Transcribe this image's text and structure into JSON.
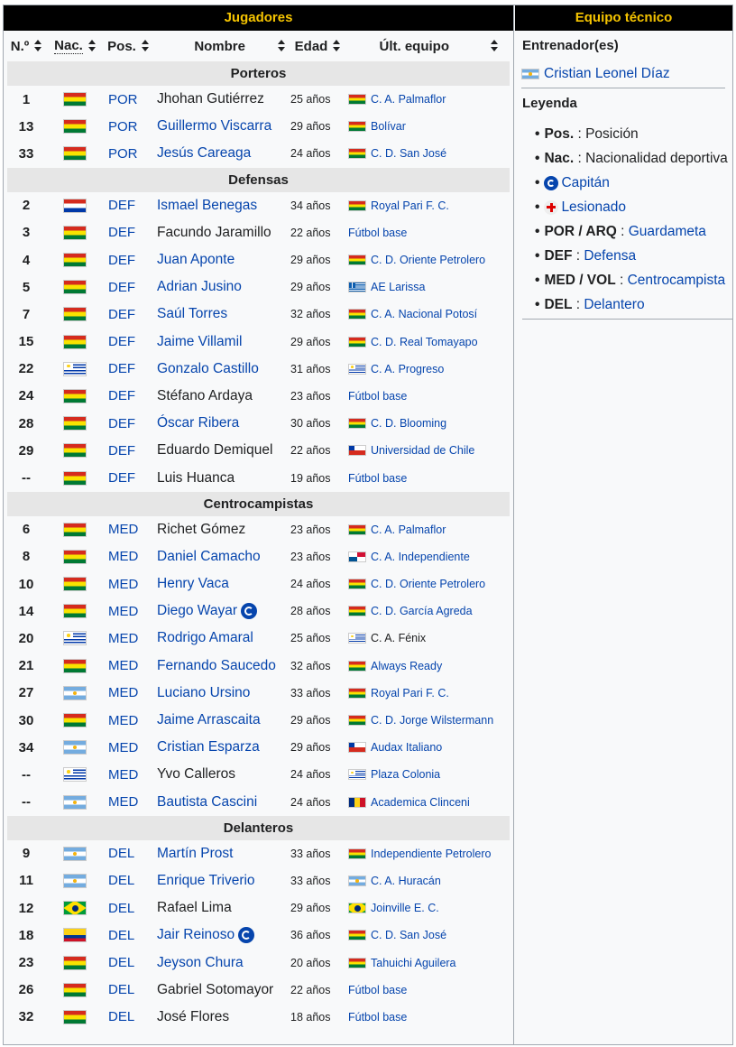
{
  "header": {
    "players_title": "Jugadores",
    "staff_title": "Equipo técnico"
  },
  "columns": {
    "num": "N.º",
    "nac": "Nac.",
    "pos": "Pos.",
    "name": "Nombre",
    "age": "Edad",
    "club": "Últ. equipo"
  },
  "sections": [
    {
      "title": "Porteros",
      "players": [
        {
          "num": "1",
          "nac": "bol",
          "pos": "POR",
          "name": "Jhohan Gutiérrez",
          "linked": false,
          "captain": false,
          "age": "25 años",
          "club_flag": "bol",
          "club": "C. A. Palmaflor",
          "club_linked": true
        },
        {
          "num": "13",
          "nac": "bol",
          "pos": "POR",
          "name": "Guillermo Viscarra",
          "linked": true,
          "captain": false,
          "age": "29 años",
          "club_flag": "bol",
          "club": "Bolívar",
          "club_linked": true
        },
        {
          "num": "33",
          "nac": "bol",
          "pos": "POR",
          "name": "Jesús Careaga",
          "linked": true,
          "captain": false,
          "age": "24 años",
          "club_flag": "bol",
          "club": "C. D. San José",
          "club_linked": true
        }
      ]
    },
    {
      "title": "Defensas",
      "players": [
        {
          "num": "2",
          "nac": "par",
          "pos": "DEF",
          "name": "Ismael Benegas",
          "linked": true,
          "captain": false,
          "age": "34 años",
          "club_flag": "bol",
          "club": "Royal Pari F. C.",
          "club_linked": true
        },
        {
          "num": "3",
          "nac": "bol",
          "pos": "DEF",
          "name": "Facundo Jaramillo",
          "linked": false,
          "captain": false,
          "age": "22 años",
          "club_flag": "",
          "club": "Fútbol base",
          "club_linked": true
        },
        {
          "num": "4",
          "nac": "bol",
          "pos": "DEF",
          "name": "Juan Aponte",
          "linked": true,
          "captain": false,
          "age": "29 años",
          "club_flag": "bol",
          "club": "C. D. Oriente Petrolero",
          "club_linked": true
        },
        {
          "num": "5",
          "nac": "bol",
          "pos": "DEF",
          "name": "Adrian Jusino",
          "linked": true,
          "captain": false,
          "age": "29 años",
          "club_flag": "gre",
          "club": "AE Larissa",
          "club_linked": true
        },
        {
          "num": "7",
          "nac": "bol",
          "pos": "DEF",
          "name": "Saúl Torres",
          "linked": true,
          "captain": false,
          "age": "32 años",
          "club_flag": "bol",
          "club": "C. A. Nacional Potosí",
          "club_linked": true
        },
        {
          "num": "15",
          "nac": "bol",
          "pos": "DEF",
          "name": "Jaime Villamil",
          "linked": true,
          "captain": false,
          "age": "29 años",
          "club_flag": "bol",
          "club": "C. D. Real Tomayapo",
          "club_linked": true
        },
        {
          "num": "22",
          "nac": "uru",
          "pos": "DEF",
          "name": "Gonzalo Castillo",
          "linked": true,
          "captain": false,
          "age": "31 años",
          "club_flag": "uru",
          "club": "C. A. Progreso",
          "club_linked": true
        },
        {
          "num": "24",
          "nac": "bol",
          "pos": "DEF",
          "name": "Stéfano Ardaya",
          "linked": false,
          "captain": false,
          "age": "23 años",
          "club_flag": "",
          "club": "Fútbol base",
          "club_linked": true
        },
        {
          "num": "28",
          "nac": "bol",
          "pos": "DEF",
          "name": "Óscar Ribera",
          "linked": true,
          "captain": false,
          "age": "30 años",
          "club_flag": "bol",
          "club": "C. D. Blooming",
          "club_linked": true
        },
        {
          "num": "29",
          "nac": "bol",
          "pos": "DEF",
          "name": "Eduardo Demiquel",
          "linked": false,
          "captain": false,
          "age": "22 años",
          "club_flag": "chi",
          "club": "Universidad de Chile",
          "club_linked": true
        },
        {
          "num": "--",
          "nac": "bol",
          "pos": "DEF",
          "name": "Luis Huanca",
          "linked": false,
          "captain": false,
          "age": "19 años",
          "club_flag": "",
          "club": "Fútbol base",
          "club_linked": true
        }
      ]
    },
    {
      "title": "Centrocampistas",
      "players": [
        {
          "num": "6",
          "nac": "bol",
          "pos": "MED",
          "name": "Richet Gómez",
          "linked": false,
          "captain": false,
          "age": "23 años",
          "club_flag": "bol",
          "club": "C. A. Palmaflor",
          "club_linked": true
        },
        {
          "num": "8",
          "nac": "bol",
          "pos": "MED",
          "name": "Daniel Camacho",
          "linked": true,
          "captain": false,
          "age": "23 años",
          "club_flag": "pan",
          "club": "C. A. Independiente",
          "club_linked": true
        },
        {
          "num": "10",
          "nac": "bol",
          "pos": "MED",
          "name": "Henry Vaca",
          "linked": true,
          "captain": false,
          "age": "24 años",
          "club_flag": "bol",
          "club": "C. D. Oriente Petrolero",
          "club_linked": true
        },
        {
          "num": "14",
          "nac": "bol",
          "pos": "MED",
          "name": "Diego Wayar",
          "linked": true,
          "captain": true,
          "age": "28 años",
          "club_flag": "bol",
          "club": "C. D. García Agreda",
          "club_linked": true
        },
        {
          "num": "20",
          "nac": "uru",
          "pos": "MED",
          "name": "Rodrigo Amaral",
          "linked": true,
          "captain": false,
          "age": "25 años",
          "club_flag": "uru",
          "club": "C. A. Fénix",
          "club_linked": false
        },
        {
          "num": "21",
          "nac": "bol",
          "pos": "MED",
          "name": "Fernando Saucedo",
          "linked": true,
          "captain": false,
          "age": "32 años",
          "club_flag": "bol",
          "club": "Always Ready",
          "club_linked": true
        },
        {
          "num": "27",
          "nac": "arg",
          "pos": "MED",
          "name": "Luciano Ursino",
          "linked": true,
          "captain": false,
          "age": "33 años",
          "club_flag": "bol",
          "club": "Royal Pari F. C.",
          "club_linked": true
        },
        {
          "num": "30",
          "nac": "bol",
          "pos": "MED",
          "name": "Jaime Arrascaita",
          "linked": true,
          "captain": false,
          "age": "29 años",
          "club_flag": "bol",
          "club": "C. D. Jorge Wilstermann",
          "club_linked": true
        },
        {
          "num": "34",
          "nac": "arg",
          "pos": "MED",
          "name": "Cristian Esparza",
          "linked": true,
          "captain": false,
          "age": "29 años",
          "club_flag": "chi",
          "club": "Audax Italiano",
          "club_linked": true
        },
        {
          "num": "--",
          "nac": "uru",
          "pos": "MED",
          "name": "Yvo Calleros",
          "linked": false,
          "captain": false,
          "age": "24 años",
          "club_flag": "uru",
          "club": "Plaza Colonia",
          "club_linked": true
        },
        {
          "num": "--",
          "nac": "arg",
          "pos": "MED",
          "name": "Bautista Cascini",
          "linked": true,
          "captain": false,
          "age": "24 años",
          "club_flag": "rom",
          "club": "Academica Clinceni",
          "club_linked": true
        }
      ]
    },
    {
      "title": "Delanteros",
      "players": [
        {
          "num": "9",
          "nac": "arg",
          "pos": "DEL",
          "name": "Martín Prost",
          "linked": true,
          "captain": false,
          "age": "33 años",
          "club_flag": "bol",
          "club": "Independiente Petrolero",
          "club_linked": true
        },
        {
          "num": "11",
          "nac": "arg",
          "pos": "DEL",
          "name": "Enrique Triverio",
          "linked": true,
          "captain": false,
          "age": "33 años",
          "club_flag": "arg",
          "club": "C. A. Huracán",
          "club_linked": true
        },
        {
          "num": "12",
          "nac": "bra",
          "pos": "DEL",
          "name": "Rafael Lima",
          "linked": false,
          "captain": false,
          "age": "29 años",
          "club_flag": "bra",
          "club": "Joinville E. C.",
          "club_linked": true
        },
        {
          "num": "18",
          "nac": "col",
          "pos": "DEL",
          "name": "Jair Reinoso",
          "linked": true,
          "captain": true,
          "age": "36 años",
          "club_flag": "bol",
          "club": "C. D. San José",
          "club_linked": true
        },
        {
          "num": "23",
          "nac": "bol",
          "pos": "DEL",
          "name": "Jeyson Chura",
          "linked": true,
          "captain": false,
          "age": "20 años",
          "club_flag": "bol",
          "club": "Tahuichi Aguilera",
          "club_linked": true
        },
        {
          "num": "26",
          "nac": "bol",
          "pos": "DEL",
          "name": "Gabriel Sotomayor",
          "linked": false,
          "captain": false,
          "age": "22 años",
          "club_flag": "",
          "club": "Fútbol base",
          "club_linked": true
        },
        {
          "num": "32",
          "nac": "bol",
          "pos": "DEL",
          "name": "José Flores",
          "linked": false,
          "captain": false,
          "age": "18 años",
          "club_flag": "",
          "club": "Fútbol base",
          "club_linked": true
        }
      ]
    }
  ],
  "staff": {
    "coach_heading": "Entrenador(es)",
    "coach_name": "Cristian Leonel Díaz",
    "coach_flag": "arg",
    "legend_title": "Leyenda",
    "legend": [
      {
        "key": "Pos.",
        "sep": " : ",
        "text": "Posición",
        "linked": false
      },
      {
        "key": "Nac.",
        "sep": " : ",
        "text": "Nacionalidad deportiva",
        "linked": false
      },
      {
        "key": "",
        "sep": "",
        "text": "Capitán",
        "linked": true,
        "icon": "captain-icon"
      },
      {
        "key": "",
        "sep": "",
        "text": "Lesionado",
        "linked": true,
        "icon": "injury-icon"
      },
      {
        "key": "POR / ARQ",
        "sep": " : ",
        "text": "Guardameta",
        "linked": true
      },
      {
        "key": "DEF",
        "sep": " : ",
        "text": "Defensa",
        "linked": true
      },
      {
        "key": "MED / VOL",
        "sep": " : ",
        "text": "Centrocampista",
        "linked": true
      },
      {
        "key": "DEL",
        "sep": " : ",
        "text": "Delantero",
        "linked": true
      }
    ]
  }
}
